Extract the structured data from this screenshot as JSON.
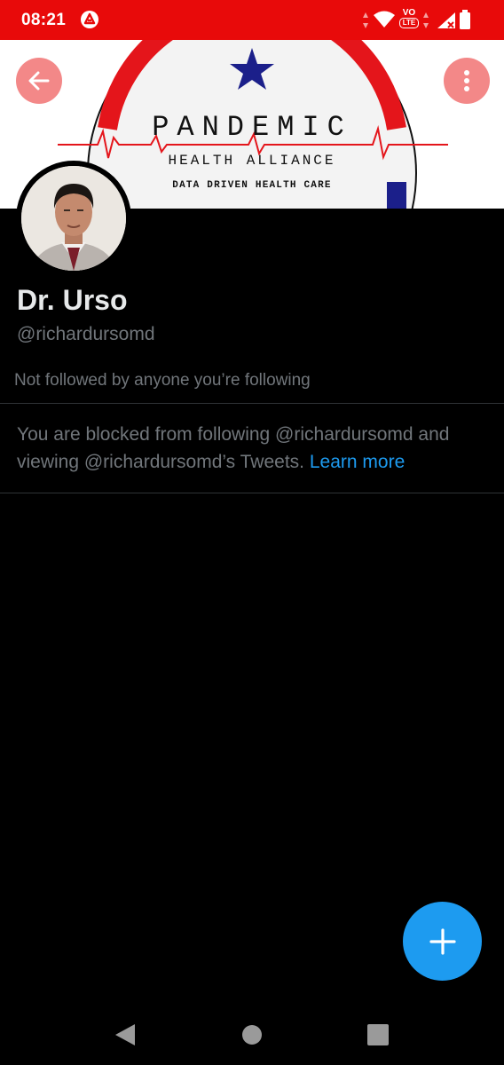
{
  "status_bar": {
    "time": "08:21",
    "network_badge_top": "VO",
    "network_badge_bottom": "LTE",
    "icons": [
      "app-notification-icon",
      "data-arrows-icon",
      "wifi-icon",
      "volte-icon",
      "signal-icon",
      "battery-icon"
    ],
    "background_color": "#e80a0a"
  },
  "banner": {
    "title": "PANDEMIC",
    "subtitle": "HEALTH ALLIANCE",
    "tagline": "DATA DRIVEN HEALTH CARE",
    "colors": {
      "red": "#e4151b",
      "blue": "#1b1f8a",
      "star": "#1b1f8a"
    }
  },
  "header": {
    "back_icon": "arrow-left-icon",
    "more_icon": "more-vertical-icon"
  },
  "profile": {
    "display_name": "Dr. Urso",
    "handle": "@richardursomd",
    "followed_note": "Not followed by anyone you’re following",
    "blocked_message": "You are blocked from following @richardursomd and viewing @richardursomd’s Tweets.",
    "learn_more": "Learn more"
  },
  "fab": {
    "icon": "plus-icon",
    "color": "#1d9bf0"
  },
  "nav": {
    "icons": [
      "nav-back-icon",
      "nav-home-icon",
      "nav-recents-icon"
    ]
  }
}
